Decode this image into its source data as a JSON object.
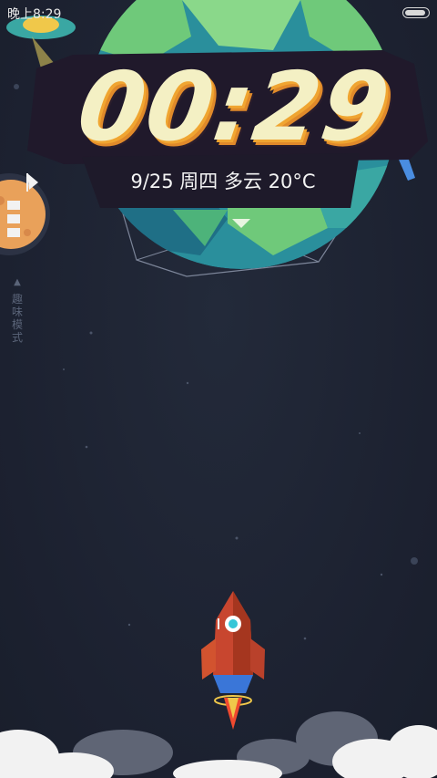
{
  "status_bar": {
    "time": "晚上8:29",
    "battery_level": 0.9
  },
  "clock": {
    "time": "00:29",
    "date_weather": "9/25 周四 多云 20°C"
  },
  "side_panel": {
    "label": "趣味模式"
  },
  "colors": {
    "background": "#1d2332",
    "clock_face": "#f4f0c4",
    "clock_shadow": "#f0a531",
    "planet_green": "#6fc97a",
    "planet_blue": "#2a8f9c",
    "rocket_red": "#c8462f"
  }
}
